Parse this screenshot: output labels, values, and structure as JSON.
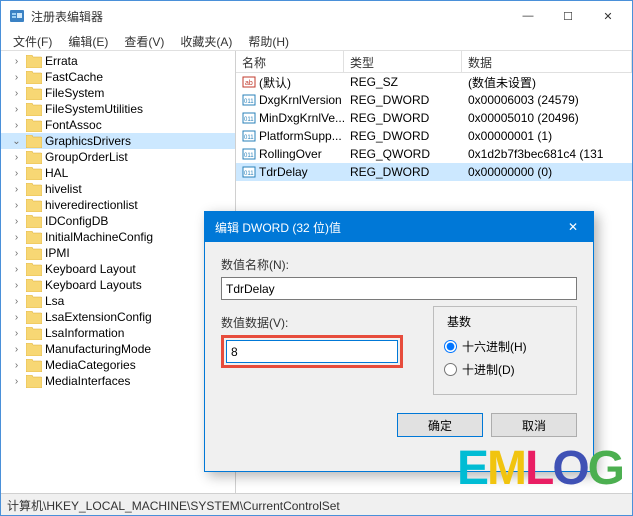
{
  "window": {
    "title": "注册表编辑器",
    "min": "—",
    "max": "☐",
    "close": "✕"
  },
  "menu": {
    "file": "文件(F)",
    "edit": "编辑(E)",
    "view": "查看(V)",
    "fav": "收藏夹(A)",
    "help": "帮助(H)"
  },
  "tree": [
    "Errata",
    "FastCache",
    "FileSystem",
    "FileSystemUtilities",
    "FontAssoc",
    "GraphicsDrivers",
    "GroupOrderList",
    "HAL",
    "hivelist",
    "hiveredirectionlist",
    "IDConfigDB",
    "InitialMachineConfig",
    "IPMI",
    "Keyboard Layout",
    "Keyboard Layouts",
    "Lsa",
    "LsaExtensionConfig",
    "LsaInformation",
    "ManufacturingMode",
    "MediaCategories",
    "MediaInterfaces"
  ],
  "tree_selected": "GraphicsDrivers",
  "columns": {
    "name": "名称",
    "type": "类型",
    "data": "数据"
  },
  "rows": [
    {
      "icon": "string",
      "name": "(默认)",
      "type": "REG_SZ",
      "data": "(数值未设置)"
    },
    {
      "icon": "dword",
      "name": "DxgKrnlVersion",
      "type": "REG_DWORD",
      "data": "0x00006003 (24579)"
    },
    {
      "icon": "dword",
      "name": "MinDxgKrnlVe...",
      "type": "REG_DWORD",
      "data": "0x00005010 (20496)"
    },
    {
      "icon": "dword",
      "name": "PlatformSupp...",
      "type": "REG_DWORD",
      "data": "0x00000001 (1)"
    },
    {
      "icon": "dword",
      "name": "RollingOver",
      "type": "REG_QWORD",
      "data": "0x1d2b7f3bec681c4 (131"
    },
    {
      "icon": "dword",
      "name": "TdrDelay",
      "type": "REG_DWORD",
      "data": "0x00000000 (0)",
      "selected": true
    }
  ],
  "statusbar": "计算机\\HKEY_LOCAL_MACHINE\\SYSTEM\\CurrentControlSet",
  "dialog": {
    "title": "编辑 DWORD (32 位)值",
    "close": "✕",
    "name_label": "数值名称(N):",
    "name_value": "TdrDelay",
    "data_label": "数值数据(V):",
    "data_value": "8",
    "base_label": "基数",
    "hex_label": "十六进制(H)",
    "dec_label": "十进制(D)",
    "ok": "确定",
    "cancel": "取消"
  },
  "watermark": [
    "E",
    "M",
    "L",
    "O",
    "G"
  ]
}
